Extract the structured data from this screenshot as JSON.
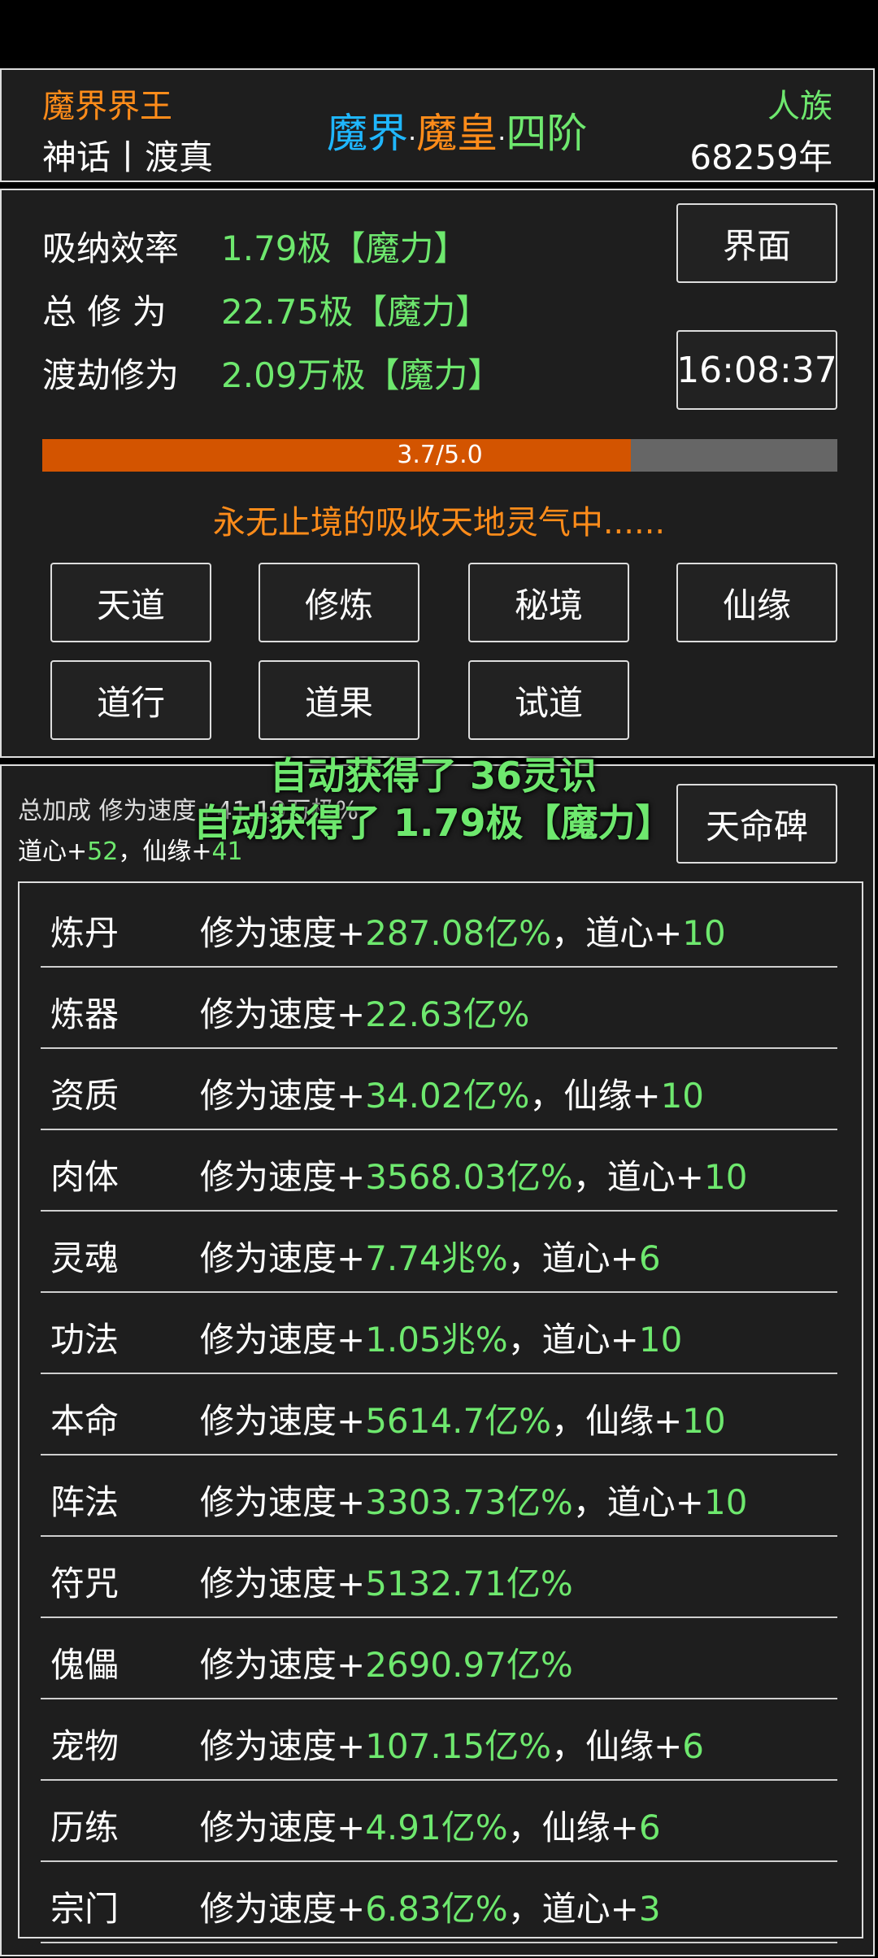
{
  "header": {
    "left_title": "魔界界王",
    "left_sub": "神话丨渡真",
    "center_a": "魔界",
    "center_dot1": "·",
    "center_b": "魔皇",
    "center_dot2": "·",
    "center_c": "四阶",
    "right_title": "人族",
    "right_sub": "68259年"
  },
  "stats": {
    "rows": [
      {
        "label": "吸纳效率",
        "value": "1.79极【魔力】"
      },
      {
        "label": "总 修 为",
        "value": "22.75极【魔力】"
      },
      {
        "label": "渡劫修为",
        "value": "2.09万极【魔力】"
      }
    ],
    "interface_btn": "界面",
    "clock": "16:08:37",
    "progress": {
      "text": "3.7/5.0",
      "fraction": 0.74
    },
    "status_line": "永无止境的吸收天地灵气中......",
    "buttons_row1": [
      "天道",
      "修炼",
      "秘境",
      "仙缘"
    ],
    "buttons_row2": [
      "道行",
      "道果",
      "试道"
    ]
  },
  "bonus": {
    "summary_line1": "总加成 修为速度+41.19万极%",
    "summary_a": "道心+",
    "summary_a_val": "52",
    "summary_sep": "，",
    "summary_b": "仙缘+",
    "summary_b_val": "41",
    "toast1": "自动获得了 36灵识",
    "toast2": "自动获得了 1.79极【魔力】",
    "tianming_btn": "天命碑",
    "items": [
      {
        "name": "炼丹",
        "prefix": "修为速度+",
        "val": "287.08亿%",
        "extra": "，道心+",
        "extra_val": "10"
      },
      {
        "name": "炼器",
        "prefix": "修为速度+",
        "val": "22.63亿%",
        "extra": "",
        "extra_val": ""
      },
      {
        "name": "资质",
        "prefix": "修为速度+",
        "val": "34.02亿%",
        "extra": "，仙缘+",
        "extra_val": "10"
      },
      {
        "name": "肉体",
        "prefix": "修为速度+",
        "val": "3568.03亿%",
        "extra": "，道心+",
        "extra_val": "10"
      },
      {
        "name": "灵魂",
        "prefix": "修为速度+",
        "val": "7.74兆%",
        "extra": "，道心+",
        "extra_val": "6"
      },
      {
        "name": "功法",
        "prefix": "修为速度+",
        "val": "1.05兆%",
        "extra": "，道心+",
        "extra_val": "10"
      },
      {
        "name": "本命",
        "prefix": "修为速度+",
        "val": "5614.7亿%",
        "extra": "，仙缘+",
        "extra_val": "10"
      },
      {
        "name": "阵法",
        "prefix": "修为速度+",
        "val": "3303.73亿%",
        "extra": "，道心+",
        "extra_val": "10"
      },
      {
        "name": "符咒",
        "prefix": "修为速度+",
        "val": "5132.71亿%",
        "extra": "",
        "extra_val": ""
      },
      {
        "name": "傀儡",
        "prefix": "修为速度+",
        "val": "2690.97亿%",
        "extra": "",
        "extra_val": ""
      },
      {
        "name": "宠物",
        "prefix": "修为速度+",
        "val": "107.15亿%",
        "extra": "，仙缘+",
        "extra_val": "6"
      },
      {
        "name": "历练",
        "prefix": "修为速度+",
        "val": "4.91亿%",
        "extra": "，仙缘+",
        "extra_val": "6"
      },
      {
        "name": "宗门",
        "prefix": "修为速度+",
        "val": "6.83亿%",
        "extra": "，道心+",
        "extra_val": "3"
      }
    ]
  },
  "colors": {
    "orange": "#ff8c1a",
    "green": "#6ee86e",
    "blue": "#1fb7ff",
    "progress_fill": "#d35400",
    "progress_track": "#666666"
  }
}
